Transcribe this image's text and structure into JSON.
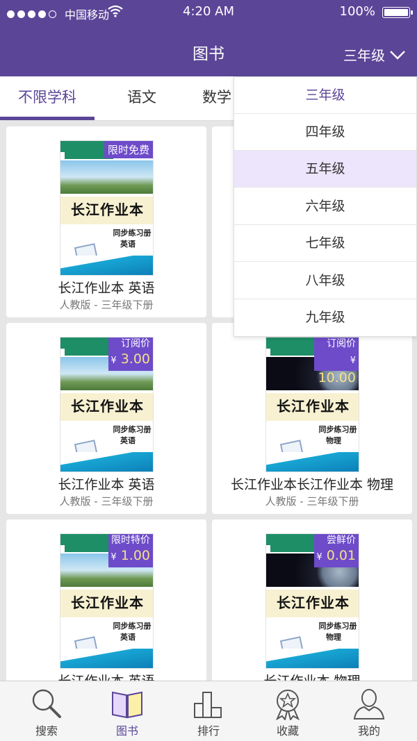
{
  "status_bar": {
    "carrier": "中国移动",
    "time": "4:20 AM",
    "battery": "100%",
    "signal_bars": 4
  },
  "header": {
    "title": "图书",
    "grade_selector": "三年级"
  },
  "subject_tabs": [
    {
      "label": "不限学科",
      "active": true
    },
    {
      "label": "语文",
      "active": false
    },
    {
      "label": "数学",
      "active": false
    }
  ],
  "grade_dropdown": {
    "options": [
      "三年级",
      "四年级",
      "五年级",
      "六年级",
      "七年级",
      "八年级",
      "九年级"
    ],
    "selected": "三年级",
    "highlighted": "五年级"
  },
  "books": [
    {
      "title": "长江作业本 英语",
      "subtitle": "人教版 - 三年级下册",
      "badge_label": "限时免费",
      "price": "",
      "cover_title": "长江作业本",
      "cover_sub": "同步练习册",
      "cover_subject": "英语"
    },
    {
      "title": "",
      "subtitle": "",
      "badge_label": "",
      "price": "",
      "cover_title": "",
      "cover_sub": "",
      "cover_subject": ""
    },
    {
      "title": "长江作业本 英语",
      "subtitle": "人教版 - 三年级下册",
      "badge_label": "订阅价",
      "price": "3.00",
      "cover_title": "长江作业本",
      "cover_sub": "同步练习册",
      "cover_subject": "英语"
    },
    {
      "title": "长江作业本长江作业本 物理",
      "subtitle": "人教版 - 三年级下册",
      "badge_label": "订阅价",
      "price": "10.00",
      "cover_title": "长江作业本",
      "cover_sub": "同步练习册",
      "cover_subject": "物理"
    },
    {
      "title": "长江作业本 英语",
      "subtitle": "",
      "badge_label": "限时特价",
      "price": "1.00",
      "cover_title": "长江作业本",
      "cover_sub": "同步练习册",
      "cover_subject": "英语"
    },
    {
      "title": "长江作业本 物理",
      "subtitle": "",
      "badge_label": "尝鲜价",
      "price": "0.01",
      "cover_title": "长江作业本",
      "cover_sub": "同步练习册",
      "cover_subject": "物理"
    }
  ],
  "currency_symbol": "¥",
  "tabbar": [
    {
      "label": "搜索",
      "icon": "search-icon",
      "active": false
    },
    {
      "label": "图书",
      "icon": "book-icon",
      "active": true
    },
    {
      "label": "排行",
      "icon": "ranking-icon",
      "active": false
    },
    {
      "label": "收藏",
      "icon": "medal-icon",
      "active": false
    },
    {
      "label": "我的",
      "icon": "user-icon",
      "active": false
    }
  ],
  "colors": {
    "primary": "#5b4597",
    "badge": "#6d4bc9",
    "dropdown_highlight": "#ece5fb"
  }
}
